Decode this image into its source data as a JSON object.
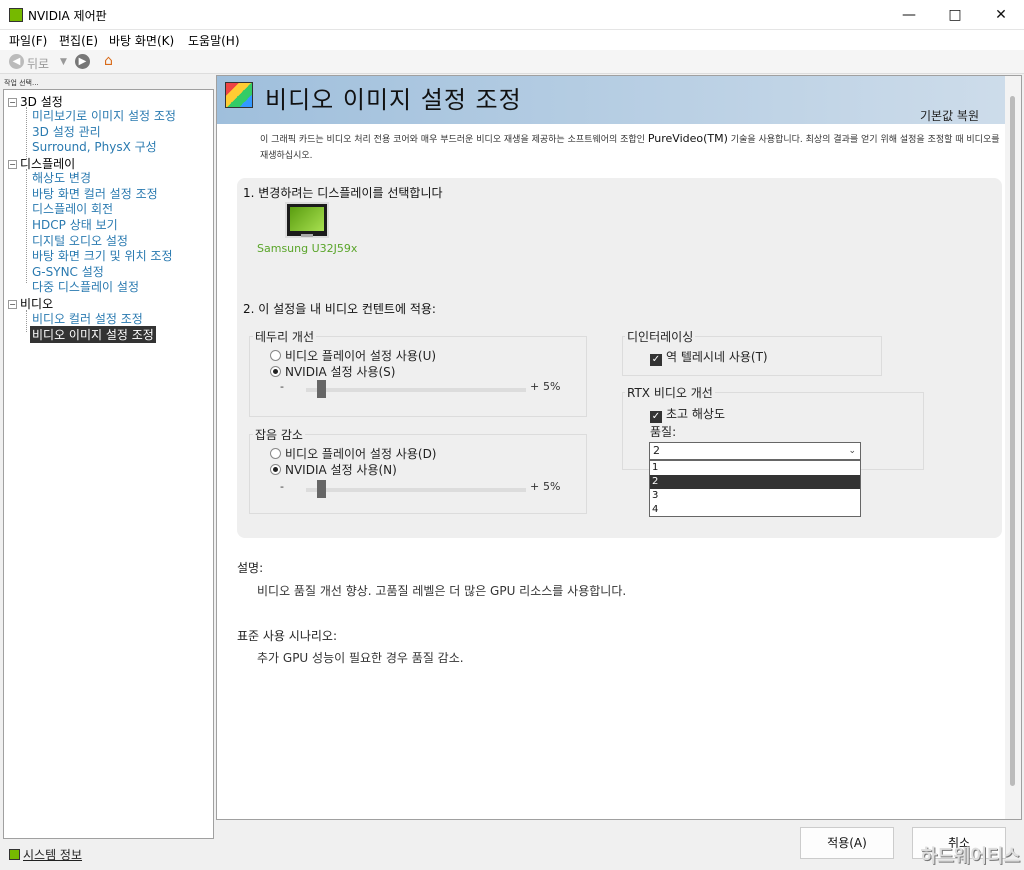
{
  "window": {
    "title": "NVIDIA 제어판",
    "minimize": "—",
    "maximize": "□",
    "close": "✕"
  },
  "menu": [
    "파일(F)",
    "편집(E)",
    "바탕 화면(K)",
    "도움말(H)"
  ],
  "toolbar": {
    "back_label": "뒤로",
    "back_icon": "back-arrow-icon",
    "forward_icon": "forward-arrow-icon",
    "home_icon": "home-icon"
  },
  "sidebar": {
    "task_label": "작업 선택...",
    "categories": [
      {
        "label": "3D 설정",
        "items": [
          "미리보기로 이미지 설정 조정",
          "3D 설정 관리",
          "Surround, PhysX 구성"
        ]
      },
      {
        "label": "디스플레이",
        "items": [
          "해상도 변경",
          "바탕 화면 컬러 설정 조정",
          "디스플레이 회전",
          "HDCP 상태 보기",
          "디지털 오디오 설정",
          "바탕 화면 크기 및 위치 조정",
          "G-SYNC 설정",
          "다중 디스플레이 설정"
        ]
      },
      {
        "label": "비디오",
        "items": [
          "비디오 컬러 설정 조정",
          "비디오 이미지 설정 조정"
        ]
      }
    ],
    "selected": "비디오 이미지 설정 조정",
    "system_info": "시스템 정보"
  },
  "page": {
    "title": "비디오 이미지 설정 조정",
    "restore_defaults": "기본값 복원",
    "intro_part1": "이 그래픽 카드는 비디오 처리 전용 코어와 매우 부드러운 비디오 재생을 제공하는 소프트웨어의 조합인",
    "intro_brand": "PureVideo(TM)",
    "intro_part2": "기술을 사용합니다. 최상의 결과를 얻기 위해 설정을 조정할 때 비디오를 재생하십시오.",
    "section1": "1. 변경하려는 디스플레이를 선택합니다",
    "display_name": "Samsung U32J59x",
    "section2": "2. 이 설정을 내 비디오 컨텐트에 적용:",
    "edge": {
      "label": "테두리 개선",
      "option1": "비디오 플레이어 설정 사용(U)",
      "option2": "NVIDIA 설정 사용(S)",
      "minus": "-",
      "plus": "+",
      "value": "5%",
      "level": 0.05
    },
    "noise": {
      "label": "잡음 감소",
      "option1": "비디오 플레이어 설정 사용(D)",
      "option2": "NVIDIA 설정 사용(N)",
      "minus": "-",
      "plus": "+",
      "value": "5%",
      "level": 0.05
    },
    "deinterlace": {
      "label": "디인터레이싱",
      "check": "역 텔레시네 사용(T)"
    },
    "rtx": {
      "label": "RTX 비디오 개선",
      "check": "초고 해상도",
      "quality_label": "품질:",
      "selected": "2",
      "options": [
        "1",
        "2",
        "3",
        "4"
      ]
    },
    "description_label": "설명:",
    "description": "비디오 품질 개선 향상. 고품질 레벨은 더 많은 GPU 리소스를 사용합니다.",
    "scenario_label": "표준 사용 시나리오:",
    "scenario": "추가 GPU 성능이 필요한 경우 품질 감소."
  },
  "buttons": {
    "apply": "적용(A)",
    "cancel": "취소"
  },
  "watermark": "하드웨어티스",
  "colors": {
    "accent": "#76b900",
    "link": "#2a7ab0",
    "banner": "#9fbfdc"
  }
}
